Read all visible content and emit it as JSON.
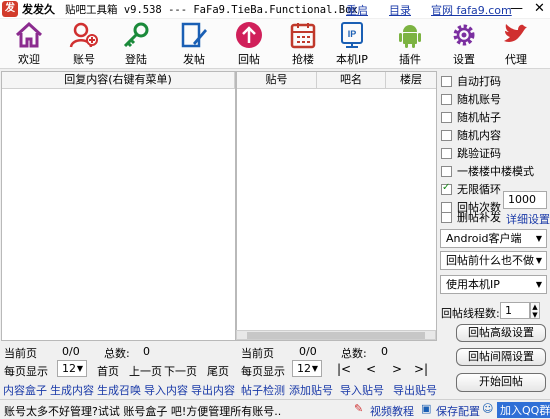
{
  "titlebar": {
    "app_name": "发发久",
    "subtitle": "贴吧工具箱 v9.538 --- FaFa9.TieBa.Functional.Box",
    "links": [
      "重启",
      "目录",
      "官网 fafa9.com"
    ],
    "min_icon": "minimize-icon",
    "close_icon": "close-icon"
  },
  "toolbar": [
    {
      "label": "欢迎",
      "icon": "home-icon",
      "color": "#8b2b8f"
    },
    {
      "label": "账号",
      "icon": "add-user-icon",
      "color": "#d03030"
    },
    {
      "label": "登陆",
      "icon": "key-icon",
      "color": "#1a8a3a"
    },
    {
      "label": "发帖",
      "icon": "pen-icon",
      "color": "#1a5fb4"
    },
    {
      "label": "回帖",
      "icon": "up-arrow-icon",
      "color": "#d0205a"
    },
    {
      "label": "抢楼",
      "icon": "building-icon",
      "color": "#c0392b"
    },
    {
      "label": "本机IP",
      "icon": "ip-icon",
      "color": "#1a5fb4"
    },
    {
      "label": "插件",
      "icon": "android-icon",
      "color": "#7cb342"
    },
    {
      "label": "设置",
      "icon": "gear-icon",
      "color": "#7b2fa0"
    },
    {
      "label": "代理",
      "icon": "bird-icon",
      "color": "#d03030"
    }
  ],
  "left_table": {
    "header": "回复内容(右键有菜单)"
  },
  "right_table": {
    "headers": [
      "贴号",
      "吧名",
      "楼层"
    ]
  },
  "left_pager": {
    "current_label": "当前页",
    "current_value": "0/0",
    "total_label": "总数:",
    "total_value": "0",
    "per_page_label": "每页显示",
    "per_page_value": "12",
    "first": "首页",
    "prev": "上一页",
    "next": "下一页",
    "last": "尾页"
  },
  "right_pager": {
    "current_label": "当前页",
    "current_value": "0/0",
    "total_label": "总数:",
    "total_value": "0",
    "per_page_label": "每页显示",
    "per_page_value": "12",
    "nav": [
      "|<",
      "<",
      ">",
      ">|"
    ]
  },
  "left_links": [
    "内容盒子",
    "生成内容",
    "生成召唤",
    "导入内容",
    "导出内容"
  ],
  "right_links": [
    "帖子检测",
    "添加贴号",
    "导入贴号",
    "导出贴号"
  ],
  "options": [
    {
      "label": "自动打码",
      "checked": false
    },
    {
      "label": "随机账号",
      "checked": false
    },
    {
      "label": "随机帖子",
      "checked": false
    },
    {
      "label": "随机内容",
      "checked": false
    },
    {
      "label": "跳验证码",
      "checked": false
    },
    {
      "label": "一楼楼中楼模式",
      "checked": false
    },
    {
      "label": "无限循环",
      "checked": true
    }
  ],
  "reply_count": {
    "label": "回帖次数",
    "value": "1000"
  },
  "delete_repost": {
    "label": "删帖补发",
    "link": "详细设置"
  },
  "dropdowns": [
    "Android客户端",
    "回帖前什么也不做",
    "使用本机IP"
  ],
  "threads": {
    "label": "回帖线程数:",
    "value": "1"
  },
  "buttons": [
    "回帖高级设置",
    "回帖间隔设置",
    "开始回帖"
  ],
  "status_bar": {
    "message": "账号太多不好管理?试试 账号盒子 吧!方便管理所有账号..",
    "video": "视频教程",
    "save": "保存配置",
    "qq": "加入QQ群"
  },
  "colors": {
    "link": "#1a3aa8",
    "check": "#1a8a1a"
  }
}
